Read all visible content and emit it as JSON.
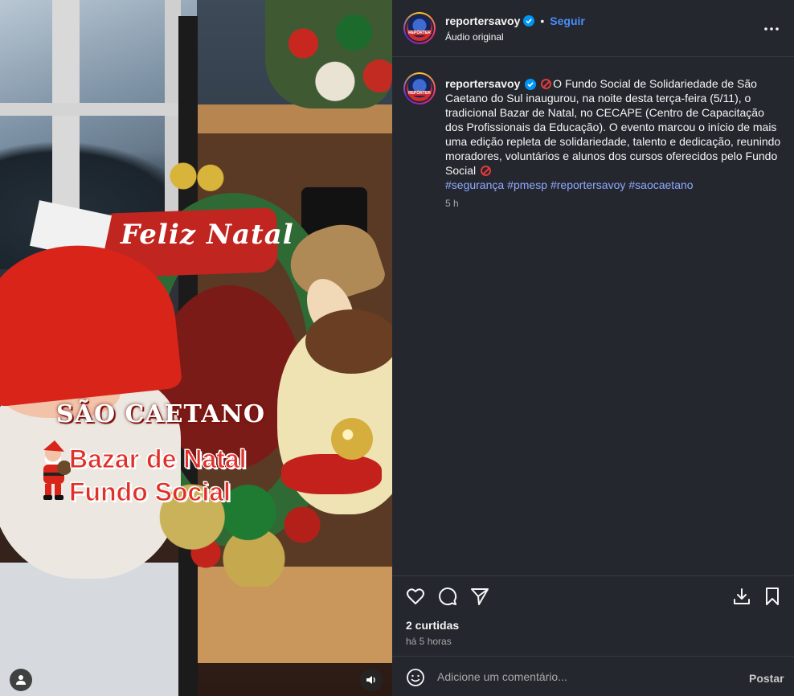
{
  "media": {
    "banner_text": "Feliz Natal",
    "overlay": {
      "city": "SÃO CAETANO",
      "line1": "Bazar de Natal",
      "line2": "Fundo Social"
    },
    "icons": {
      "user_tag": "person-icon",
      "audio": "speaker-icon"
    }
  },
  "header": {
    "username": "reportersavoy",
    "follow": "Seguir",
    "separator": "•",
    "audio": "Áudio original",
    "avatar_badge": "REPÓRTER"
  },
  "caption": {
    "username": "reportersavoy",
    "text": "O Fundo Social de Solidariedade de São Caetano do Sul inaugurou, na noite desta terça-feira (5/11), o tradicional Bazar de Natal, no CECAPE (Centro de Capacitação dos Profissionais da Educação). O evento marcou o início de mais uma edição repleta de solidariedade, talento e dedicação, reunindo moradores, voluntários e alunos dos cursos oferecidos pelo Fundo Social",
    "hashtags": [
      "#segurança",
      "#pmesp",
      "#reportersavoy",
      "#saocaetano"
    ],
    "time": "5 h"
  },
  "stats": {
    "likes": "2 curtidas",
    "posted": "há 5 horas"
  },
  "comment": {
    "placeholder": "Adicione um comentário...",
    "post": "Postar"
  },
  "colors": {
    "panel_bg": "#25272e",
    "accent": "#4a8dfc",
    "hashtag": "#8fa9ff",
    "overlay_red": "#e0302a"
  }
}
